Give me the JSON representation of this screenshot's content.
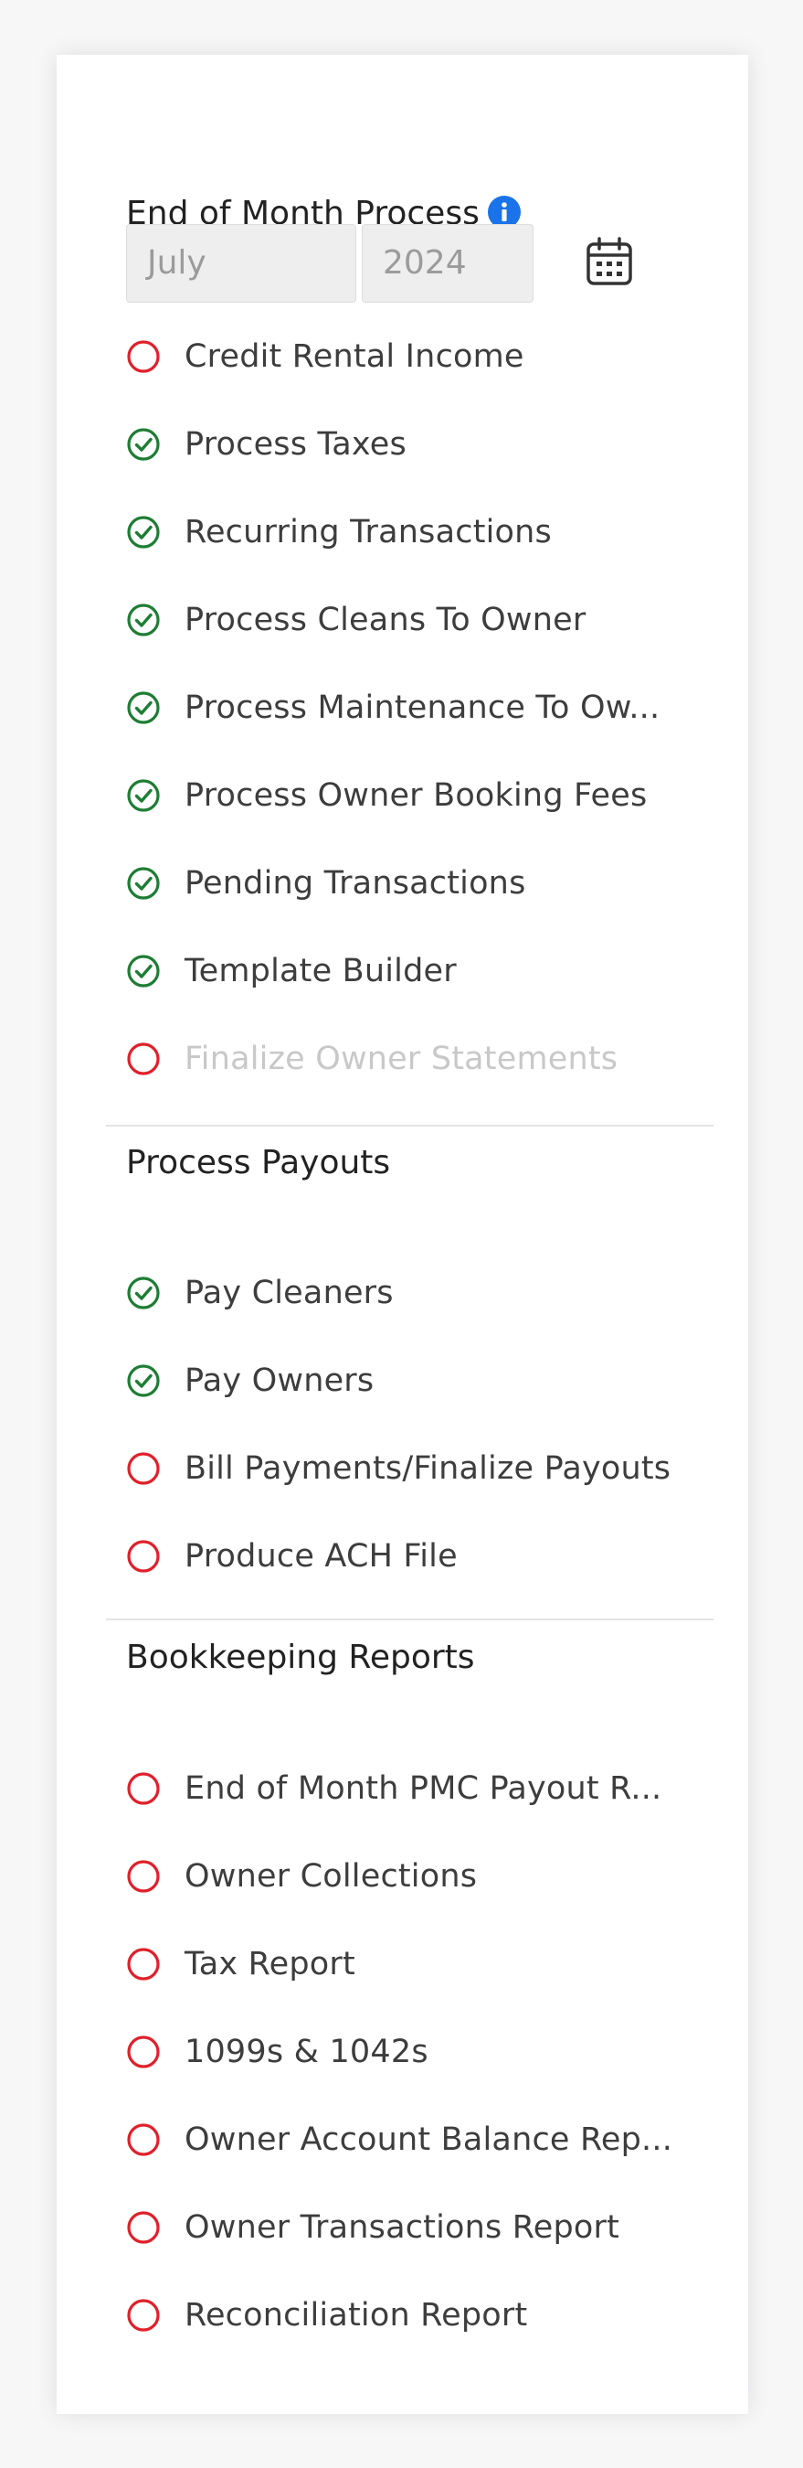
{
  "colors": {
    "pending": "#e0202a",
    "complete": "#1e7d34",
    "info": "#1a73e8"
  },
  "header": {
    "title": "End of Month Process",
    "info_icon": "info-icon"
  },
  "period": {
    "month": "July",
    "year": "2024",
    "calendar_icon": "calendar-icon"
  },
  "eom": {
    "items": [
      {
        "label": "Credit Rental Income",
        "status": "pending"
      },
      {
        "label": "Process Taxes",
        "status": "complete"
      },
      {
        "label": "Recurring Transactions",
        "status": "complete"
      },
      {
        "label": "Process Cleans To Owner",
        "status": "complete"
      },
      {
        "label": "Process Maintenance To Ow...",
        "status": "complete"
      },
      {
        "label": "Process Owner Booking Fees",
        "status": "complete"
      },
      {
        "label": "Pending Transactions",
        "status": "complete"
      },
      {
        "label": "Template Builder",
        "status": "complete"
      },
      {
        "label": "Finalize Owner Statements",
        "status": "pending",
        "disabled": true
      }
    ]
  },
  "payouts": {
    "title": "Process Payouts",
    "items": [
      {
        "label": "Pay Cleaners",
        "status": "complete"
      },
      {
        "label": "Pay Owners",
        "status": "complete"
      },
      {
        "label": "Bill Payments/Finalize Payouts",
        "status": "pending"
      },
      {
        "label": "Produce ACH File",
        "status": "pending"
      }
    ]
  },
  "reports": {
    "title": "Bookkeeping Reports",
    "items": [
      {
        "label": "End of Month PMC Payout R...",
        "status": "pending"
      },
      {
        "label": "Owner Collections",
        "status": "pending"
      },
      {
        "label": "Tax Report",
        "status": "pending"
      },
      {
        "label": "1099s & 1042s",
        "status": "pending"
      },
      {
        "label": "Owner Account Balance Rep...",
        "status": "pending"
      },
      {
        "label": "Owner Transactions Report",
        "status": "pending"
      },
      {
        "label": "Reconciliation Report",
        "status": "pending"
      }
    ]
  }
}
